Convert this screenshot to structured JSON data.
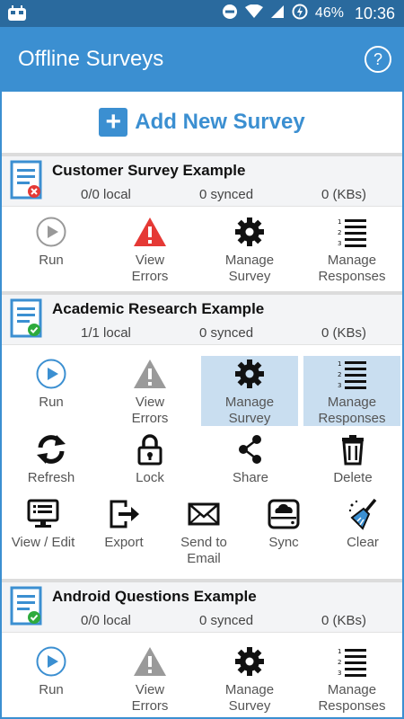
{
  "status_bar": {
    "battery": "46%",
    "time": "10:36"
  },
  "app_bar": {
    "title": "Offline Surveys",
    "help_label": "?"
  },
  "add_survey": {
    "label": "Add New Survey"
  },
  "surveys": [
    {
      "title": "Customer Survey Example",
      "local": "0/0 local",
      "synced": "0 synced",
      "size": "0 (KBs)",
      "status": "error",
      "actions": [
        {
          "label": "Run",
          "icon": "play-icon"
        },
        {
          "label": "View\nErrors",
          "icon": "warning-icon"
        },
        {
          "label": "Manage\nSurvey",
          "icon": "gear-icon"
        },
        {
          "label": "Manage\nResponses",
          "icon": "list-icon"
        }
      ]
    },
    {
      "title": "Academic Research Example",
      "local": "1/1 local",
      "synced": "0 synced",
      "size": "0 (KBs)",
      "status": "ok",
      "actions": [
        {
          "label": "Run",
          "icon": "play-icon"
        },
        {
          "label": "View\nErrors",
          "icon": "warning-icon"
        },
        {
          "label": "Manage\nSurvey",
          "icon": "gear-icon"
        },
        {
          "label": "Manage\nResponses",
          "icon": "list-icon"
        },
        {
          "label": "Refresh",
          "icon": "refresh-icon"
        },
        {
          "label": "Lock",
          "icon": "lock-icon"
        },
        {
          "label": "Share",
          "icon": "share-icon"
        },
        {
          "label": "Delete",
          "icon": "trash-icon"
        },
        {
          "label": "View / Edit",
          "icon": "monitor-icon"
        },
        {
          "label": "Export",
          "icon": "export-icon"
        },
        {
          "label": "Send to\nEmail",
          "icon": "email-icon"
        },
        {
          "label": "Sync",
          "icon": "cloud-drive-icon"
        },
        {
          "label": "Clear",
          "icon": "broom-icon"
        }
      ]
    },
    {
      "title": "Android Questions Example",
      "local": "0/0 local",
      "synced": "0 synced",
      "size": "0 (KBs)",
      "status": "ok",
      "actions": [
        {
          "label": "Run",
          "icon": "play-icon"
        },
        {
          "label": "View\nErrors",
          "icon": "warning-icon"
        },
        {
          "label": "Manage\nSurvey",
          "icon": "gear-icon"
        },
        {
          "label": "Manage\nResponses",
          "icon": "list-icon"
        }
      ]
    }
  ],
  "colors": {
    "primary": "#3b8fd1",
    "status_bar": "#2a6a9e",
    "error": "#e53935",
    "ok": "#2eaa3c",
    "selected": "#c9def0"
  }
}
